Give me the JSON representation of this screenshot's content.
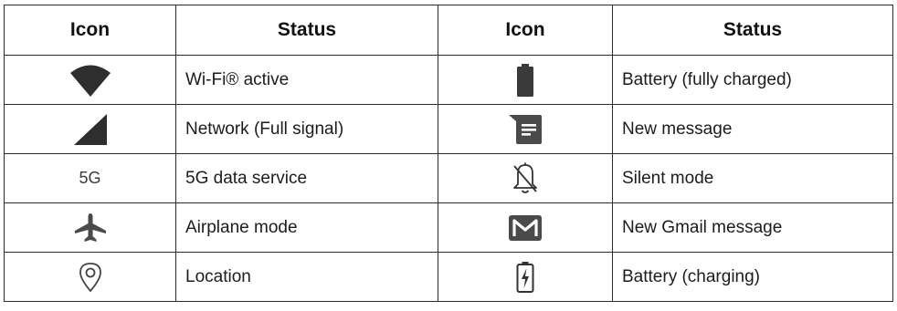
{
  "table": {
    "headers": [
      "Icon",
      "Status",
      "Icon",
      "Status"
    ],
    "rows": [
      {
        "left_icon": "wifi-icon",
        "left_status": "Wi-Fi® active",
        "right_icon": "battery-full-icon",
        "right_status": "Battery (fully charged)"
      },
      {
        "left_icon": "signal-full-icon",
        "left_status": "Network (Full signal)",
        "right_icon": "message-icon",
        "right_status": "New message"
      },
      {
        "left_icon": "5g-icon",
        "left_icon_text": "5G",
        "left_status": "5G data service",
        "right_icon": "bell-off-icon",
        "right_status": "Silent mode"
      },
      {
        "left_icon": "airplane-icon",
        "left_status": "Airplane mode",
        "right_icon": "gmail-icon",
        "right_status": "New Gmail message"
      },
      {
        "left_icon": "location-pin-icon",
        "left_status": "Location",
        "right_icon": "battery-charging-icon",
        "right_status": "Battery (charging)"
      }
    ]
  },
  "colors": {
    "icon_dark": "#2e2e2e",
    "icon_gray": "#5a5a5a",
    "border": "#2b2b2b"
  }
}
